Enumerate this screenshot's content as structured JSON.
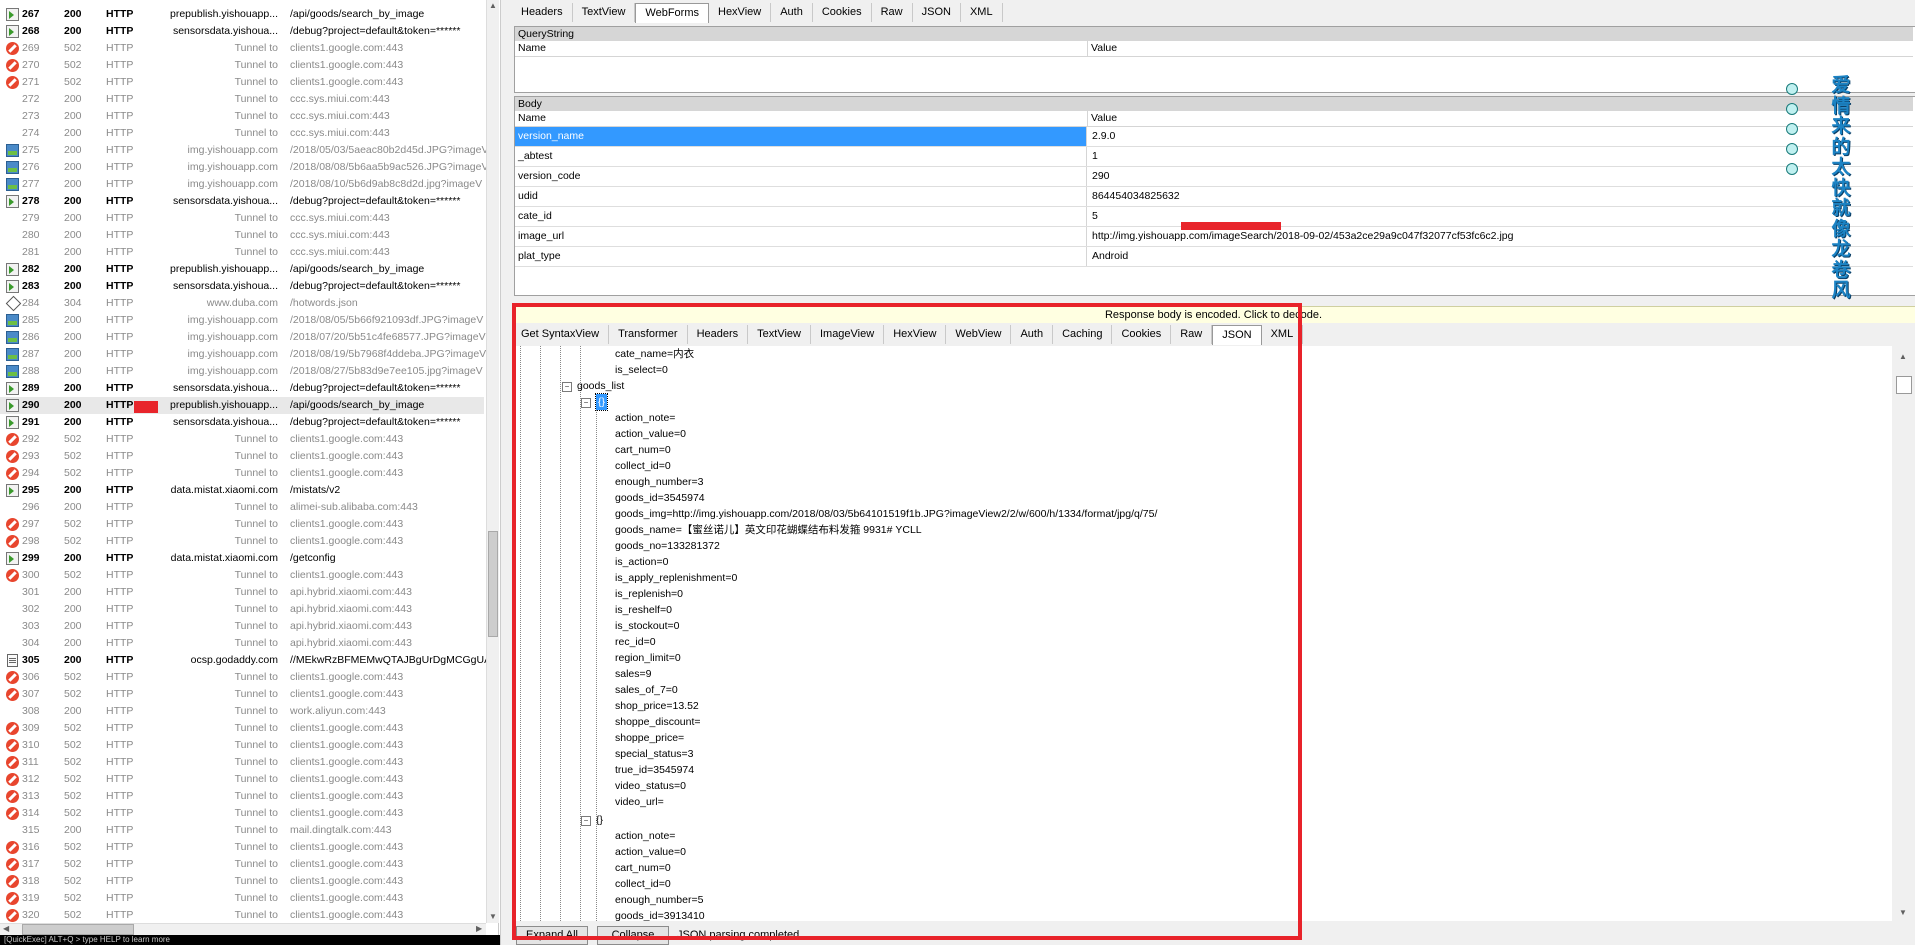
{
  "sessions": [
    {
      "num": "267",
      "result": "200",
      "protocol": "HTTP",
      "host": "prepublish.yishouapp...",
      "url": "/api/goods/search_by_image",
      "icon": "api",
      "style": "bold"
    },
    {
      "num": "268",
      "result": "200",
      "protocol": "HTTP",
      "host": "sensorsdata.yishoua...",
      "url": "/debug?project=default&token=******",
      "icon": "api",
      "style": "bold"
    },
    {
      "num": "269",
      "result": "502",
      "protocol": "HTTP",
      "host": "Tunnel to",
      "url": "clients1.google.com:443",
      "icon": "err",
      "style": "tunnel"
    },
    {
      "num": "270",
      "result": "502",
      "protocol": "HTTP",
      "host": "Tunnel to",
      "url": "clients1.google.com:443",
      "icon": "err",
      "style": "tunnel"
    },
    {
      "num": "271",
      "result": "502",
      "protocol": "HTTP",
      "host": "Tunnel to",
      "url": "clients1.google.com:443",
      "icon": "err",
      "style": "tunnel"
    },
    {
      "num": "272",
      "result": "200",
      "protocol": "HTTP",
      "host": "Tunnel to",
      "url": "ccc.sys.miui.com:443",
      "icon": "none",
      "style": "tunnel"
    },
    {
      "num": "273",
      "result": "200",
      "protocol": "HTTP",
      "host": "Tunnel to",
      "url": "ccc.sys.miui.com:443",
      "icon": "none",
      "style": "tunnel"
    },
    {
      "num": "274",
      "result": "200",
      "protocol": "HTTP",
      "host": "Tunnel to",
      "url": "ccc.sys.miui.com:443",
      "icon": "none",
      "style": "tunnel"
    },
    {
      "num": "275",
      "result": "200",
      "protocol": "HTTP",
      "host": "img.yishouapp.com",
      "url": "/2018/05/03/5aeac80b2d45d.JPG?imageV",
      "icon": "img",
      "style": "tunnel"
    },
    {
      "num": "276",
      "result": "200",
      "protocol": "HTTP",
      "host": "img.yishouapp.com",
      "url": "/2018/08/08/5b6aa5b9ac526.JPG?imageV",
      "icon": "img",
      "style": "tunnel"
    },
    {
      "num": "277",
      "result": "200",
      "protocol": "HTTP",
      "host": "img.yishouapp.com",
      "url": "/2018/08/10/5b6d9ab8c8d2d.jpg?imageV",
      "icon": "img",
      "style": "tunnel"
    },
    {
      "num": "278",
      "result": "200",
      "protocol": "HTTP",
      "host": "sensorsdata.yishoua...",
      "url": "/debug?project=default&token=******",
      "icon": "api",
      "style": "bold"
    },
    {
      "num": "279",
      "result": "200",
      "protocol": "HTTP",
      "host": "Tunnel to",
      "url": "ccc.sys.miui.com:443",
      "icon": "none",
      "style": "tunnel"
    },
    {
      "num": "280",
      "result": "200",
      "protocol": "HTTP",
      "host": "Tunnel to",
      "url": "ccc.sys.miui.com:443",
      "icon": "none",
      "style": "tunnel"
    },
    {
      "num": "281",
      "result": "200",
      "protocol": "HTTP",
      "host": "Tunnel to",
      "url": "ccc.sys.miui.com:443",
      "icon": "none",
      "style": "tunnel"
    },
    {
      "num": "282",
      "result": "200",
      "protocol": "HTTP",
      "host": "prepublish.yishouapp...",
      "url": "/api/goods/search_by_image",
      "icon": "api",
      "style": "bold"
    },
    {
      "num": "283",
      "result": "200",
      "protocol": "HTTP",
      "host": "sensorsdata.yishoua...",
      "url": "/debug?project=default&token=******",
      "icon": "api",
      "style": "bold"
    },
    {
      "num": "284",
      "result": "304",
      "protocol": "HTTP",
      "host": "www.duba.com",
      "url": "/hotwords.json",
      "icon": "dia",
      "style": "tunnel"
    },
    {
      "num": "285",
      "result": "200",
      "protocol": "HTTP",
      "host": "img.yishouapp.com",
      "url": "/2018/08/05/5b66f921093df.JPG?imageV",
      "icon": "img",
      "style": "tunnel"
    },
    {
      "num": "286",
      "result": "200",
      "protocol": "HTTP",
      "host": "img.yishouapp.com",
      "url": "/2018/07/20/5b51c4fe68577.JPG?imageV",
      "icon": "img",
      "style": "tunnel"
    },
    {
      "num": "287",
      "result": "200",
      "protocol": "HTTP",
      "host": "img.yishouapp.com",
      "url": "/2018/08/19/5b7968f4ddeba.JPG?imageV",
      "icon": "img",
      "style": "tunnel"
    },
    {
      "num": "288",
      "result": "200",
      "protocol": "HTTP",
      "host": "img.yishouapp.com",
      "url": "/2018/08/27/5b83d9e7ee105.jpg?imageV",
      "icon": "img",
      "style": "tunnel"
    },
    {
      "num": "289",
      "result": "200",
      "protocol": "HTTP",
      "host": "sensorsdata.yishoua...",
      "url": "/debug?project=default&token=******",
      "icon": "api",
      "style": "bold"
    },
    {
      "num": "290",
      "result": "200",
      "protocol": "HTTP",
      "host": "prepublish.yishouapp...",
      "url": "/api/goods/search_by_image",
      "icon": "api",
      "style": "bold",
      "selected": true
    },
    {
      "num": "291",
      "result": "200",
      "protocol": "HTTP",
      "host": "sensorsdata.yishoua...",
      "url": "/debug?project=default&token=******",
      "icon": "api",
      "style": "bold"
    },
    {
      "num": "292",
      "result": "502",
      "protocol": "HTTP",
      "host": "Tunnel to",
      "url": "clients1.google.com:443",
      "icon": "err",
      "style": "tunnel"
    },
    {
      "num": "293",
      "result": "502",
      "protocol": "HTTP",
      "host": "Tunnel to",
      "url": "clients1.google.com:443",
      "icon": "err",
      "style": "tunnel"
    },
    {
      "num": "294",
      "result": "502",
      "protocol": "HTTP",
      "host": "Tunnel to",
      "url": "clients1.google.com:443",
      "icon": "err",
      "style": "tunnel"
    },
    {
      "num": "295",
      "result": "200",
      "protocol": "HTTP",
      "host": "data.mistat.xiaomi.com",
      "url": "/mistats/v2",
      "icon": "api",
      "style": "bold"
    },
    {
      "num": "296",
      "result": "200",
      "protocol": "HTTP",
      "host": "Tunnel to",
      "url": "alimei-sub.alibaba.com:443",
      "icon": "none",
      "style": "tunnel"
    },
    {
      "num": "297",
      "result": "502",
      "protocol": "HTTP",
      "host": "Tunnel to",
      "url": "clients1.google.com:443",
      "icon": "err",
      "style": "tunnel"
    },
    {
      "num": "298",
      "result": "502",
      "protocol": "HTTP",
      "host": "Tunnel to",
      "url": "clients1.google.com:443",
      "icon": "err",
      "style": "tunnel"
    },
    {
      "num": "299",
      "result": "200",
      "protocol": "HTTP",
      "host": "data.mistat.xiaomi.com",
      "url": "/getconfig",
      "icon": "api",
      "style": "bold"
    },
    {
      "num": "300",
      "result": "502",
      "protocol": "HTTP",
      "host": "Tunnel to",
      "url": "clients1.google.com:443",
      "icon": "err",
      "style": "tunnel"
    },
    {
      "num": "301",
      "result": "200",
      "protocol": "HTTP",
      "host": "Tunnel to",
      "url": "api.hybrid.xiaomi.com:443",
      "icon": "none",
      "style": "tunnel"
    },
    {
      "num": "302",
      "result": "200",
      "protocol": "HTTP",
      "host": "Tunnel to",
      "url": "api.hybrid.xiaomi.com:443",
      "icon": "none",
      "style": "tunnel"
    },
    {
      "num": "303",
      "result": "200",
      "protocol": "HTTP",
      "host": "Tunnel to",
      "url": "api.hybrid.xiaomi.com:443",
      "icon": "none",
      "style": "tunnel"
    },
    {
      "num": "304",
      "result": "200",
      "protocol": "HTTP",
      "host": "Tunnel to",
      "url": "api.hybrid.xiaomi.com:443",
      "icon": "none",
      "style": "tunnel"
    },
    {
      "num": "305",
      "result": "200",
      "protocol": "HTTP",
      "host": "ocsp.godaddy.com",
      "url": "//MEkwRzBFMEMwQTAJBgUrDgMCGgUABE",
      "icon": "doc",
      "style": "bold"
    },
    {
      "num": "306",
      "result": "502",
      "protocol": "HTTP",
      "host": "Tunnel to",
      "url": "clients1.google.com:443",
      "icon": "err",
      "style": "tunnel"
    },
    {
      "num": "307",
      "result": "502",
      "protocol": "HTTP",
      "host": "Tunnel to",
      "url": "clients1.google.com:443",
      "icon": "err",
      "style": "tunnel"
    },
    {
      "num": "308",
      "result": "200",
      "protocol": "HTTP",
      "host": "Tunnel to",
      "url": "work.aliyun.com:443",
      "icon": "none",
      "style": "tunnel"
    },
    {
      "num": "309",
      "result": "502",
      "protocol": "HTTP",
      "host": "Tunnel to",
      "url": "clients1.google.com:443",
      "icon": "err",
      "style": "tunnel"
    },
    {
      "num": "310",
      "result": "502",
      "protocol": "HTTP",
      "host": "Tunnel to",
      "url": "clients1.google.com:443",
      "icon": "err",
      "style": "tunnel"
    },
    {
      "num": "311",
      "result": "502",
      "protocol": "HTTP",
      "host": "Tunnel to",
      "url": "clients1.google.com:443",
      "icon": "err",
      "style": "tunnel"
    },
    {
      "num": "312",
      "result": "502",
      "protocol": "HTTP",
      "host": "Tunnel to",
      "url": "clients1.google.com:443",
      "icon": "err",
      "style": "tunnel"
    },
    {
      "num": "313",
      "result": "502",
      "protocol": "HTTP",
      "host": "Tunnel to",
      "url": "clients1.google.com:443",
      "icon": "err",
      "style": "tunnel"
    },
    {
      "num": "314",
      "result": "502",
      "protocol": "HTTP",
      "host": "Tunnel to",
      "url": "clients1.google.com:443",
      "icon": "err",
      "style": "tunnel"
    },
    {
      "num": "315",
      "result": "200",
      "protocol": "HTTP",
      "host": "Tunnel to",
      "url": "mail.dingtalk.com:443",
      "icon": "none",
      "style": "tunnel"
    },
    {
      "num": "316",
      "result": "502",
      "protocol": "HTTP",
      "host": "Tunnel to",
      "url": "clients1.google.com:443",
      "icon": "err",
      "style": "tunnel"
    },
    {
      "num": "317",
      "result": "502",
      "protocol": "HTTP",
      "host": "Tunnel to",
      "url": "clients1.google.com:443",
      "icon": "err",
      "style": "tunnel"
    },
    {
      "num": "318",
      "result": "502",
      "protocol": "HTTP",
      "host": "Tunnel to",
      "url": "clients1.google.com:443",
      "icon": "err",
      "style": "tunnel"
    },
    {
      "num": "319",
      "result": "502",
      "protocol": "HTTP",
      "host": "Tunnel to",
      "url": "clients1.google.com:443",
      "icon": "err",
      "style": "tunnel"
    },
    {
      "num": "320",
      "result": "502",
      "protocol": "HTTP",
      "host": "Tunnel to",
      "url": "clients1.google.com:443",
      "icon": "err",
      "style": "tunnel"
    }
  ],
  "quickexec_text": "[QuickExec] ALT+Q > type HELP to learn more",
  "request_tabs": [
    "Headers",
    "TextView",
    "WebForms",
    "HexView",
    "Auth",
    "Cookies",
    "Raw",
    "JSON",
    "XML"
  ],
  "request_active_tab": "WebForms",
  "querystring": {
    "title": "QueryString",
    "col_name": "Name",
    "col_value": "Value"
  },
  "body": {
    "title": "Body",
    "col_name": "Name",
    "col_value": "Value",
    "rows": [
      {
        "name": "version_name",
        "value": "2.9.0",
        "selected": true
      },
      {
        "name": "_abtest",
        "value": "1"
      },
      {
        "name": "version_code",
        "value": "290"
      },
      {
        "name": "udid",
        "value": "864454034825632"
      },
      {
        "name": "cate_id",
        "value": "5"
      },
      {
        "name": "image_url",
        "value": "http://img.yishouapp.com/imageSearch/2018-09-02/453a2ce29a9c047f32077cf53fc6c2.jpg"
      },
      {
        "name": "plat_type",
        "value": "Android"
      }
    ]
  },
  "encoded_notice": "Response body is encoded. Click to decode.",
  "response_tabs": [
    "Get SyntaxView",
    "Transformer",
    "Headers",
    "TextView",
    "ImageView",
    "HexView",
    "WebView",
    "Auth",
    "Caching",
    "Cookies",
    "Raw",
    "JSON",
    "XML"
  ],
  "response_active_tab": "JSON",
  "tree": {
    "pre": [
      "cate_name=内衣",
      "is_select=0"
    ],
    "goods_list_label": "goods_list",
    "item0_label": "{}",
    "item0": [
      "action_note=",
      "action_value=0",
      "cart_num=0",
      "collect_id=0",
      "enough_number=3",
      "goods_id=3545974",
      "goods_img=http://img.yishouapp.com/2018/08/03/5b64101519f1b.JPG?imageView2/2/w/600/h/1334/format/jpg/q/75/",
      "goods_name=【蜜丝诺儿】英文印花蝴蝶结布料发箍 9931# YCLL",
      "goods_no=133281372",
      "is_action=0",
      "is_apply_replenishment=0",
      "is_replenish=0",
      "is_reshelf=0",
      "is_stockout=0",
      "rec_id=0",
      "region_limit=0",
      "sales=9",
      "sales_of_7=0",
      "shop_price=13.52",
      "shoppe_discount=",
      "shoppe_price=",
      "special_status=3",
      "true_id=3545974",
      "video_status=0",
      "video_url="
    ],
    "item1_label": "{}",
    "item1": [
      "action_note=",
      "action_value=0",
      "cart_num=0",
      "collect_id=0",
      "enough_number=5",
      "goods_id=3913410"
    ]
  },
  "buttons": {
    "expand_all": "Expand All",
    "collapse": "Collapse"
  },
  "status_text": "JSON parsing completed.",
  "watermark": "爱情来的太快就像龙卷风",
  "colors": {
    "highlight": "#3399ff",
    "annotation_red": "#e8232a",
    "watermark": "#1c83c4"
  }
}
